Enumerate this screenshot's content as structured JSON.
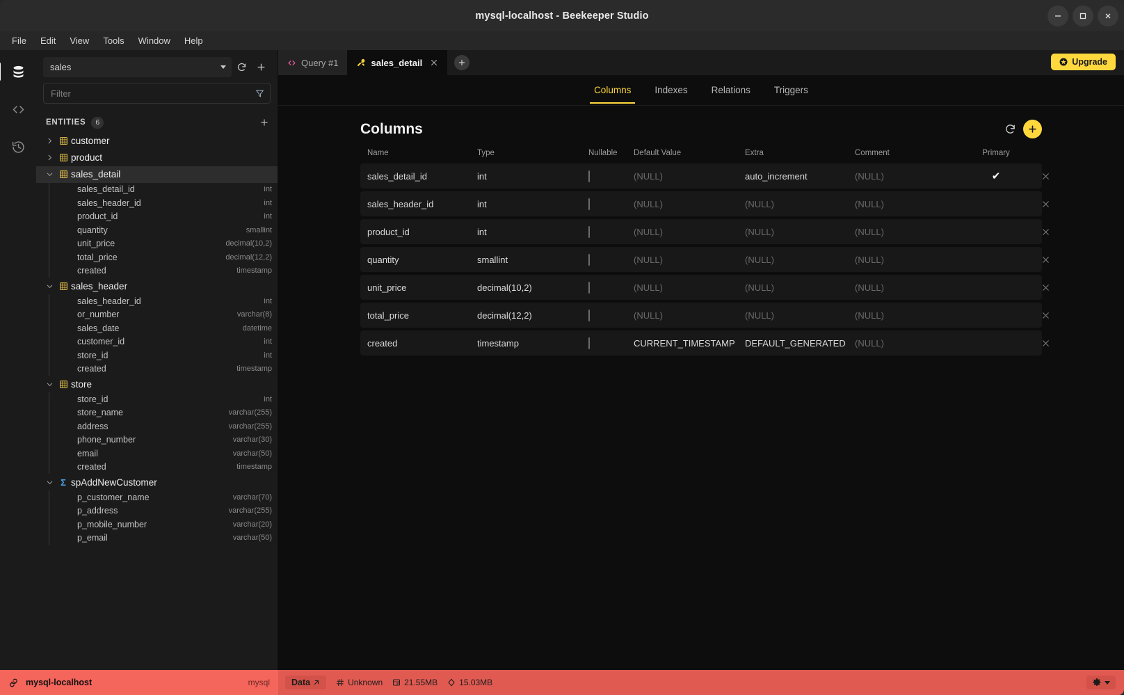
{
  "window": {
    "title": "mysql-localhost - Beekeeper Studio",
    "minimize_label": "minimize-window",
    "maximize_label": "maximize-window",
    "close_label": "close-window"
  },
  "menubar": {
    "items": [
      {
        "label": "File"
      },
      {
        "label": "Edit"
      },
      {
        "label": "View"
      },
      {
        "label": "Tools"
      },
      {
        "label": "Window"
      },
      {
        "label": "Help"
      }
    ]
  },
  "rail": {
    "items": [
      {
        "name": "database-icon",
        "active": true
      },
      {
        "name": "code-icon",
        "active": false
      },
      {
        "name": "history-icon",
        "active": false
      }
    ]
  },
  "sidebar": {
    "database": {
      "value": "sales"
    },
    "refresh_label": "refresh-database",
    "add_label": "add-database",
    "filter": {
      "placeholder": "Filter"
    },
    "entities": {
      "label": "ENTITIES",
      "count": "6",
      "add_label": "add-entity"
    },
    "tree": [
      {
        "name": "customer",
        "kind": "table",
        "expanded": false,
        "selected": false,
        "columns": []
      },
      {
        "name": "product",
        "kind": "table",
        "expanded": false,
        "selected": false,
        "columns": []
      },
      {
        "name": "sales_detail",
        "kind": "table",
        "expanded": true,
        "selected": true,
        "columns": [
          {
            "name": "sales_detail_id",
            "type": "int"
          },
          {
            "name": "sales_header_id",
            "type": "int"
          },
          {
            "name": "product_id",
            "type": "int"
          },
          {
            "name": "quantity",
            "type": "smallint"
          },
          {
            "name": "unit_price",
            "type": "decimal(10,2)"
          },
          {
            "name": "total_price",
            "type": "decimal(12,2)"
          },
          {
            "name": "created",
            "type": "timestamp"
          }
        ]
      },
      {
        "name": "sales_header",
        "kind": "table",
        "expanded": true,
        "selected": false,
        "columns": [
          {
            "name": "sales_header_id",
            "type": "int"
          },
          {
            "name": "or_number",
            "type": "varchar(8)"
          },
          {
            "name": "sales_date",
            "type": "datetime"
          },
          {
            "name": "customer_id",
            "type": "int"
          },
          {
            "name": "store_id",
            "type": "int"
          },
          {
            "name": "created",
            "type": "timestamp"
          }
        ]
      },
      {
        "name": "store",
        "kind": "table",
        "expanded": true,
        "selected": false,
        "columns": [
          {
            "name": "store_id",
            "type": "int"
          },
          {
            "name": "store_name",
            "type": "varchar(255)"
          },
          {
            "name": "address",
            "type": "varchar(255)"
          },
          {
            "name": "phone_number",
            "type": "varchar(30)"
          },
          {
            "name": "email",
            "type": "varchar(50)"
          },
          {
            "name": "created",
            "type": "timestamp"
          }
        ]
      },
      {
        "name": "spAddNewCustomer",
        "kind": "procedure",
        "expanded": true,
        "selected": false,
        "columns": [
          {
            "name": "p_customer_name",
            "type": "varchar(70)"
          },
          {
            "name": "p_address",
            "type": "varchar(255)"
          },
          {
            "name": "p_mobile_number",
            "type": "varchar(20)"
          },
          {
            "name": "p_email",
            "type": "varchar(50)"
          }
        ]
      }
    ]
  },
  "tabs": [
    {
      "label": "Query #1",
      "icon": "code-icon",
      "active": false,
      "closable": false
    },
    {
      "label": "sales_detail",
      "icon": "table-structure-icon",
      "active": true,
      "closable": true
    }
  ],
  "tab_add_label": "new-tab",
  "upgrade": {
    "label": "Upgrade",
    "icon": "star-icon",
    "color": "#ffd83d"
  },
  "subtabs": [
    {
      "label": "Columns",
      "active": true
    },
    {
      "label": "Indexes",
      "active": false
    },
    {
      "label": "Relations",
      "active": false
    },
    {
      "label": "Triggers",
      "active": false
    }
  ],
  "columns_panel": {
    "title": "Columns",
    "refresh_label": "refresh-columns",
    "add_label": "add-column",
    "headers": [
      "Name",
      "Type",
      "Nullable",
      "Default Value",
      "Extra",
      "Comment",
      "Primary"
    ],
    "rows": [
      {
        "name": "sales_detail_id",
        "type": "int",
        "nullable": false,
        "default": "(NULL)",
        "extra": "auto_increment",
        "comment": "(NULL)",
        "primary": true
      },
      {
        "name": "sales_header_id",
        "type": "int",
        "nullable": false,
        "default": "(NULL)",
        "extra": "(NULL)",
        "comment": "(NULL)",
        "primary": false
      },
      {
        "name": "product_id",
        "type": "int",
        "nullable": false,
        "default": "(NULL)",
        "extra": "(NULL)",
        "comment": "(NULL)",
        "primary": false
      },
      {
        "name": "quantity",
        "type": "smallint",
        "nullable": false,
        "default": "(NULL)",
        "extra": "(NULL)",
        "comment": "(NULL)",
        "primary": false
      },
      {
        "name": "unit_price",
        "type": "decimal(10,2)",
        "nullable": false,
        "default": "(NULL)",
        "extra": "(NULL)",
        "comment": "(NULL)",
        "primary": false
      },
      {
        "name": "total_price",
        "type": "decimal(12,2)",
        "nullable": false,
        "default": "(NULL)",
        "extra": "(NULL)",
        "comment": "(NULL)",
        "primary": false
      },
      {
        "name": "created",
        "type": "timestamp",
        "nullable": false,
        "default": "CURRENT_TIMESTAMP",
        "extra": "DEFAULT_GENERATED",
        "comment": "(NULL)",
        "primary": false
      }
    ]
  },
  "statusbar": {
    "connection_name": "mysql-localhost",
    "driver": "mysql",
    "data_button": "Data",
    "metrics": [
      {
        "icon": "hash-icon",
        "value": "Unknown"
      },
      {
        "icon": "table-size-icon",
        "value": "21.55MB"
      },
      {
        "icon": "index-size-icon",
        "value": "15.03MB"
      }
    ],
    "settings_label": "connection-settings",
    "color": "#e05a52"
  }
}
